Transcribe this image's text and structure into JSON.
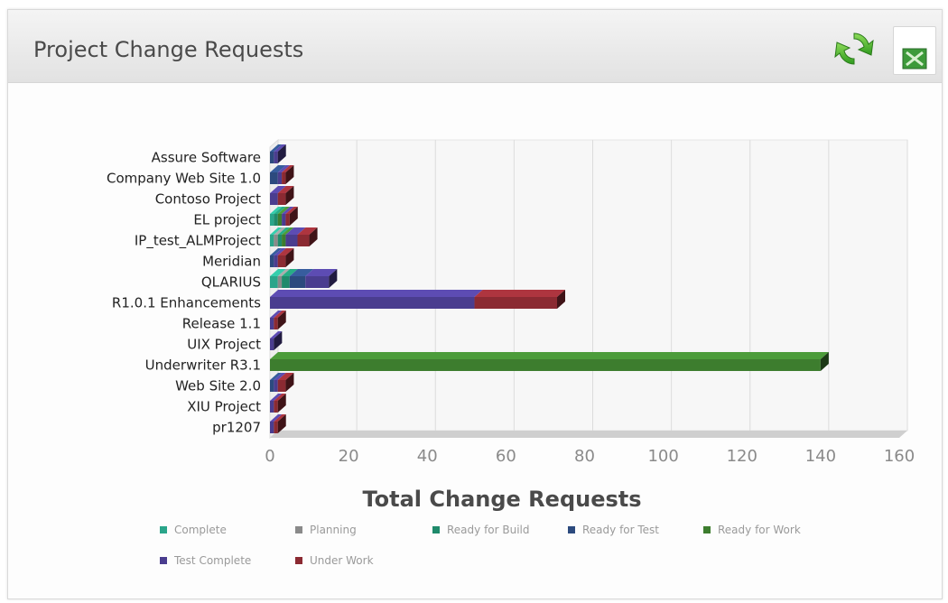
{
  "panel": {
    "title": "Project Change Requests"
  },
  "icons": {
    "refresh": "refresh-icon",
    "export": "excel-export-icon"
  },
  "colors": {
    "Complete": "#2aa58a",
    "Planning": "#8a8a8a",
    "Ready for Build": "#1f8a6b",
    "Ready for Test": "#2c4a7e",
    "Ready for Work": "#3d7d2e",
    "Test Complete": "#4a3d8f",
    "Under Work": "#8b2a32",
    "Green bar": "#2f8a2f",
    "Purple bar": "#6b3fa8"
  },
  "chart_data": {
    "type": "bar",
    "orientation": "horizontal",
    "stacked": true,
    "three_d": true,
    "categories": [
      "Assure Software",
      "Company Web Site 1.0",
      "Contoso Project",
      "EL project",
      "IP_test_ALMProject",
      "Meridian",
      "QLARIUS",
      "R1.0.1 Enhancements",
      "Release 1.1",
      "UIX Project",
      "Underwriter R3.1",
      "Web Site 2.0",
      "XIU Project",
      "pr1207"
    ],
    "series": [
      {
        "name": "Complete",
        "color": "#2aa58a",
        "values": [
          0,
          0,
          0,
          1,
          1,
          0,
          2,
          0,
          0,
          0,
          0,
          0,
          0,
          0
        ]
      },
      {
        "name": "Planning",
        "color": "#8a8a8a",
        "values": [
          0,
          0,
          0,
          0,
          1,
          0,
          1,
          0,
          0,
          0,
          0,
          0,
          0,
          0
        ]
      },
      {
        "name": "Ready for Build",
        "color": "#1f8a6b",
        "values": [
          0,
          0,
          0,
          1,
          1,
          0,
          2,
          0,
          0,
          0,
          0,
          0,
          0,
          0
        ]
      },
      {
        "name": "Ready for Test",
        "color": "#2c4a7e",
        "values": [
          1,
          2,
          0,
          0,
          0,
          1,
          4,
          0,
          0,
          0,
          0,
          1,
          0,
          0
        ]
      },
      {
        "name": "Ready for Work",
        "color": "#3d7d2e",
        "values": [
          0,
          0,
          0,
          1,
          1,
          0,
          0,
          0,
          0,
          0,
          140,
          0,
          0,
          0
        ]
      },
      {
        "name": "Test Complete",
        "color": "#4a3d8f",
        "values": [
          1,
          1,
          2,
          1,
          3,
          1,
          6,
          52,
          1,
          1,
          0,
          1,
          1,
          1
        ]
      },
      {
        "name": "Under Work",
        "color": "#8b2a32",
        "values": [
          0,
          1,
          2,
          1,
          3,
          2,
          0,
          21,
          1,
          0,
          0,
          2,
          1,
          1
        ]
      }
    ],
    "xlabel": "Total Change Requests",
    "xlim": [
      0,
      160
    ],
    "xticks": [
      0,
      20,
      40,
      60,
      80,
      100,
      120,
      140,
      160
    ],
    "grid": true,
    "legend_position": "bottom"
  }
}
